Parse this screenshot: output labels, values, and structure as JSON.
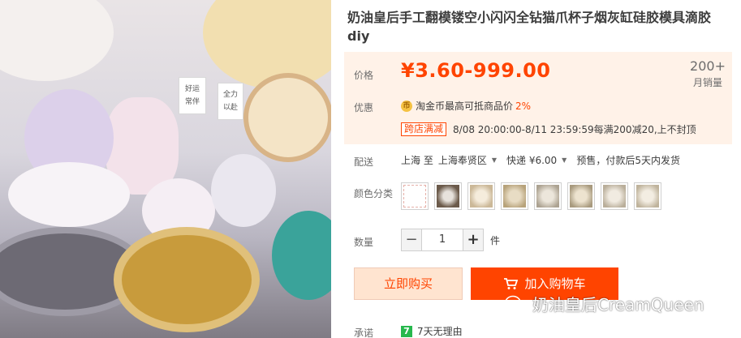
{
  "product": {
    "title": "奶油皇后手工翻模镂空小闪闪全钻猫爪杯子烟灰缸硅胶模具滴胶diy"
  },
  "photo": {
    "cards": [
      "好运\n常伴",
      "全力\n以赴"
    ]
  },
  "price": {
    "label": "价格",
    "value": "¥3.60-999.00",
    "sales_count": "200+",
    "sales_unit": "月销量"
  },
  "promotion": {
    "label": "优惠",
    "coin_icon": "coin-icon",
    "coin_text": "淘金币最高可抵商品价",
    "coin_pct": "2%",
    "tag": "跨店满减",
    "detail": "8/08 20:00:00-8/11 23:59:59每满200减20,上不封顶"
  },
  "shipping": {
    "label": "配送",
    "from": "上海 至",
    "to": "上海奉贤区",
    "fee": "快递 ¥6.00",
    "note": "预售，付款后5天内发货"
  },
  "color": {
    "label": "颜色分类",
    "swatches": [
      "#ffffff",
      "#6b5a4a",
      "#e8dcc8",
      "#d9c9a8",
      "#cfc6b6",
      "#c7bca4",
      "#d7cfbf",
      "#ddd3c0"
    ]
  },
  "quantity": {
    "label": "数量",
    "minus": "−",
    "value": "1",
    "plus": "+",
    "unit": "件"
  },
  "actions": {
    "buy_now": "立即购买",
    "add_cart": "加入购物车"
  },
  "promise": {
    "label": "承诺",
    "badge": "7",
    "text": "7天无理由"
  },
  "watermark": {
    "text": "奶油皇后CreamQueen"
  },
  "colors": {
    "accent": "#ff4400",
    "price_bg": "#fff2e8",
    "buy_bg": "#ffe4d0"
  }
}
